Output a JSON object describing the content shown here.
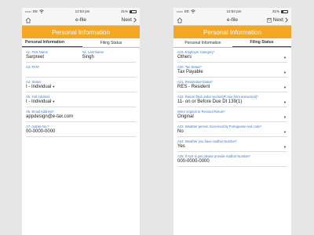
{
  "status": {
    "carrier": "EE",
    "signal_dots": "•••••",
    "time": "12:53 pm",
    "battery": "31%"
  },
  "nav": {
    "title": "e-file",
    "next_label": "Next"
  },
  "banner": {
    "title": "Personal Information"
  },
  "tabs": {
    "personal": "Personal Information",
    "filing": "Filing Status"
  },
  "left_form": {
    "first_name": {
      "label": "A1. First Name",
      "value": "Sarpreet"
    },
    "last_name": {
      "label": "A2. Last Name",
      "value": "Singh"
    },
    "pan": {
      "label": "A3. PAN*",
      "value": ""
    },
    "status": {
      "label": "A4. Status",
      "value": "I - Individual"
    },
    "full_address": {
      "label": "A5. Full Address",
      "value": "I - Individual"
    },
    "email": {
      "label": "A6. Email Address*",
      "value": "appdesign@e-tax.com"
    },
    "mobile": {
      "label": "A7. mobile No.*",
      "value": "00-0000-0000"
    }
  },
  "right_form": {
    "employer_category": {
      "label": "A19. Employer Category*",
      "value": "Others"
    },
    "tax_status": {
      "label": "A20. Tax Status*",
      "value": "Tax Payable"
    },
    "residential_status": {
      "label": "A21. Residential Status*",
      "value": "RES - Resident"
    },
    "return_filed": {
      "label": "A22. Return filed under section[Pl see form instruction]*",
      "value": "11- on or Before Due Dt 139(1)"
    },
    "original_revised": {
      "label": "Were original or Revised Return*",
      "value": "Original"
    },
    "portuguese": {
      "label": "A23. Weather person Governed by Portuguese civil code*",
      "value": "No"
    },
    "aadhar": {
      "label": "A24. Weather you have Aadhar Number*",
      "value": "Yes"
    },
    "aadhar_no": {
      "label": "A25. If A24 is yes please provide Aadhar Number*",
      "value": "000-0000-0000"
    }
  },
  "colors": {
    "accent": "#f5a623",
    "label": "#3a7ad6"
  }
}
